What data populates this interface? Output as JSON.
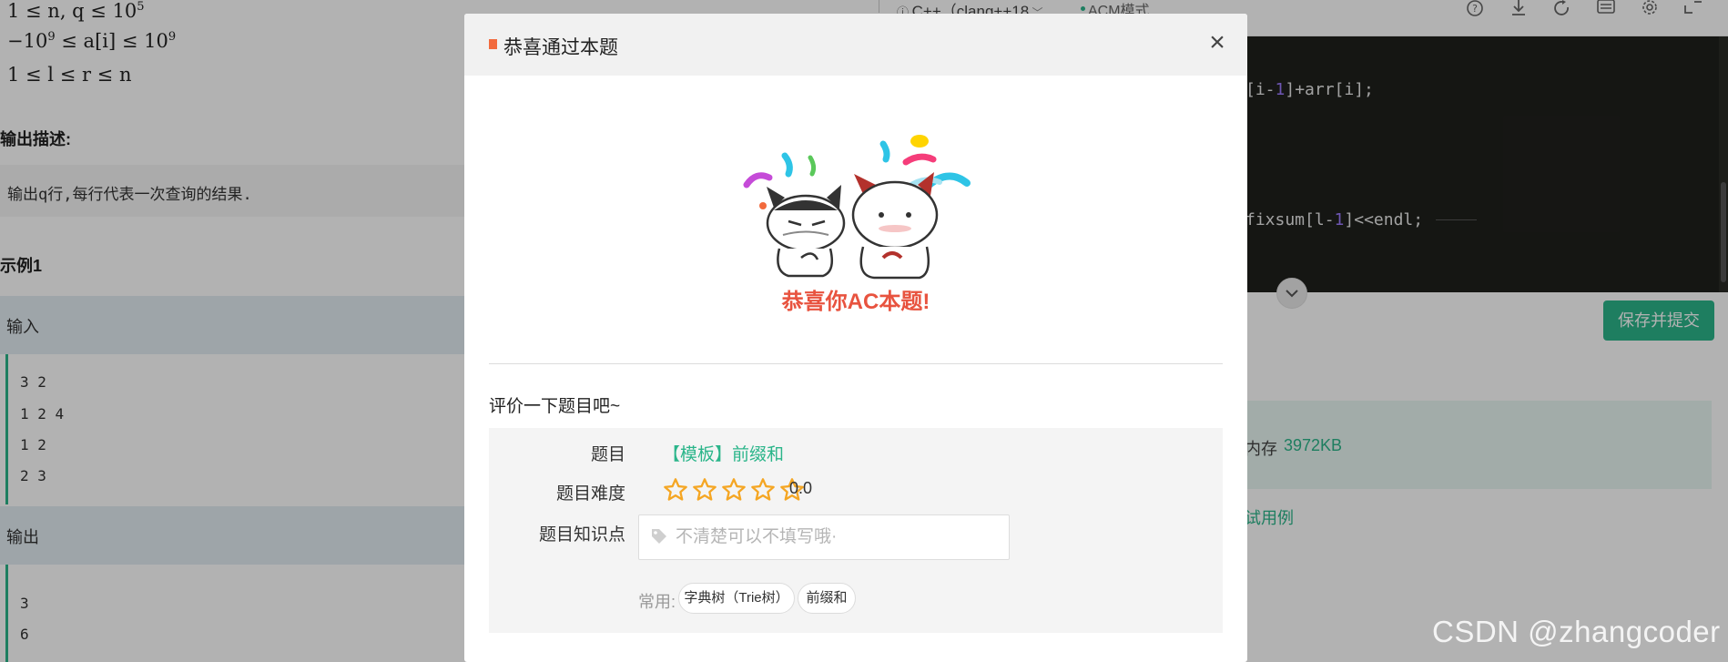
{
  "problem": {
    "constraints": {
      "c1": "1 ≤ n, q ≤ 10",
      "c1_sup": "5",
      "c2_a": "−10",
      "c2_sup1": "9",
      "c2_b": " ≤ a[i] ≤ 10",
      "c2_sup2": "9",
      "c3": "1 ≤ l ≤ r ≤ n"
    },
    "output_title": "输出描述:",
    "output_desc": "输出q行,每行代表一次查询的结果.",
    "example_title": "示例1",
    "input_label": "输入",
    "input_lines": [
      "3 2",
      "1 2 4",
      "1 2",
      "2 3"
    ],
    "output_label": "输出",
    "output_lines": [
      "3",
      "6"
    ]
  },
  "editor": {
    "language": "C++（clang++18",
    "mode": "ACM模式",
    "line1": {
      "pre": "[i-",
      "num": "1",
      "post": "]+arr[i];"
    },
    "line2": {
      "pre": "fixsum[l-",
      "num": "1",
      "post": "]<<endl;"
    },
    "save_label": "保存并提交",
    "memory_label": "内存",
    "memory_value": "3972KB",
    "test_link": "试用例"
  },
  "modal": {
    "title": "恭喜通过本题",
    "close_glyph": "×",
    "congrats": "恭喜你AC本题!",
    "rate_title": "评价一下题目吧~",
    "problem_label": "题目",
    "problem_name": "【模板】前缀和",
    "difficulty_label": "题目难度",
    "rating": 0,
    "score_text": "0.0",
    "knowledge_label": "题目知识点",
    "knowledge_placeholder": "不清楚可以不填写哦·",
    "common_label": "常用:",
    "chips": [
      "字典树（Trie树）",
      "前缀和"
    ]
  },
  "watermark": "CSDN @zhangcoder",
  "colors": {
    "accent": "#2bb58a",
    "congrats": "#e8533f",
    "star": "#f5a623",
    "title_mark": "#f26a3d",
    "editor_bg": "#1f201c"
  }
}
